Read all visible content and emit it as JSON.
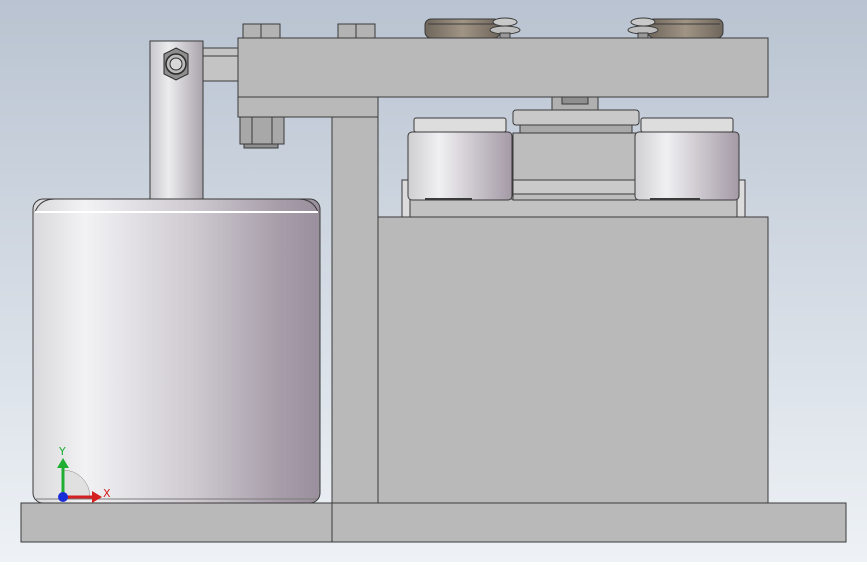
{
  "viewport": {
    "background_top": "#b9c3d1",
    "background_bottom": "#eef2f6"
  },
  "colors": {
    "plate_fill": "#b9b9b9",
    "plate_stroke": "#3a3a3a",
    "cylinder_light": "#f2f2f4",
    "cylinder_dark": "#9a8f9c",
    "bolt_fill": "#a8a8a8",
    "washer_fill": "#8c8276"
  },
  "triad": {
    "x_label": "X",
    "y_label": "Y",
    "x_color": "#d42020",
    "y_color": "#1fae32",
    "z_color": "#1a2ed8"
  }
}
